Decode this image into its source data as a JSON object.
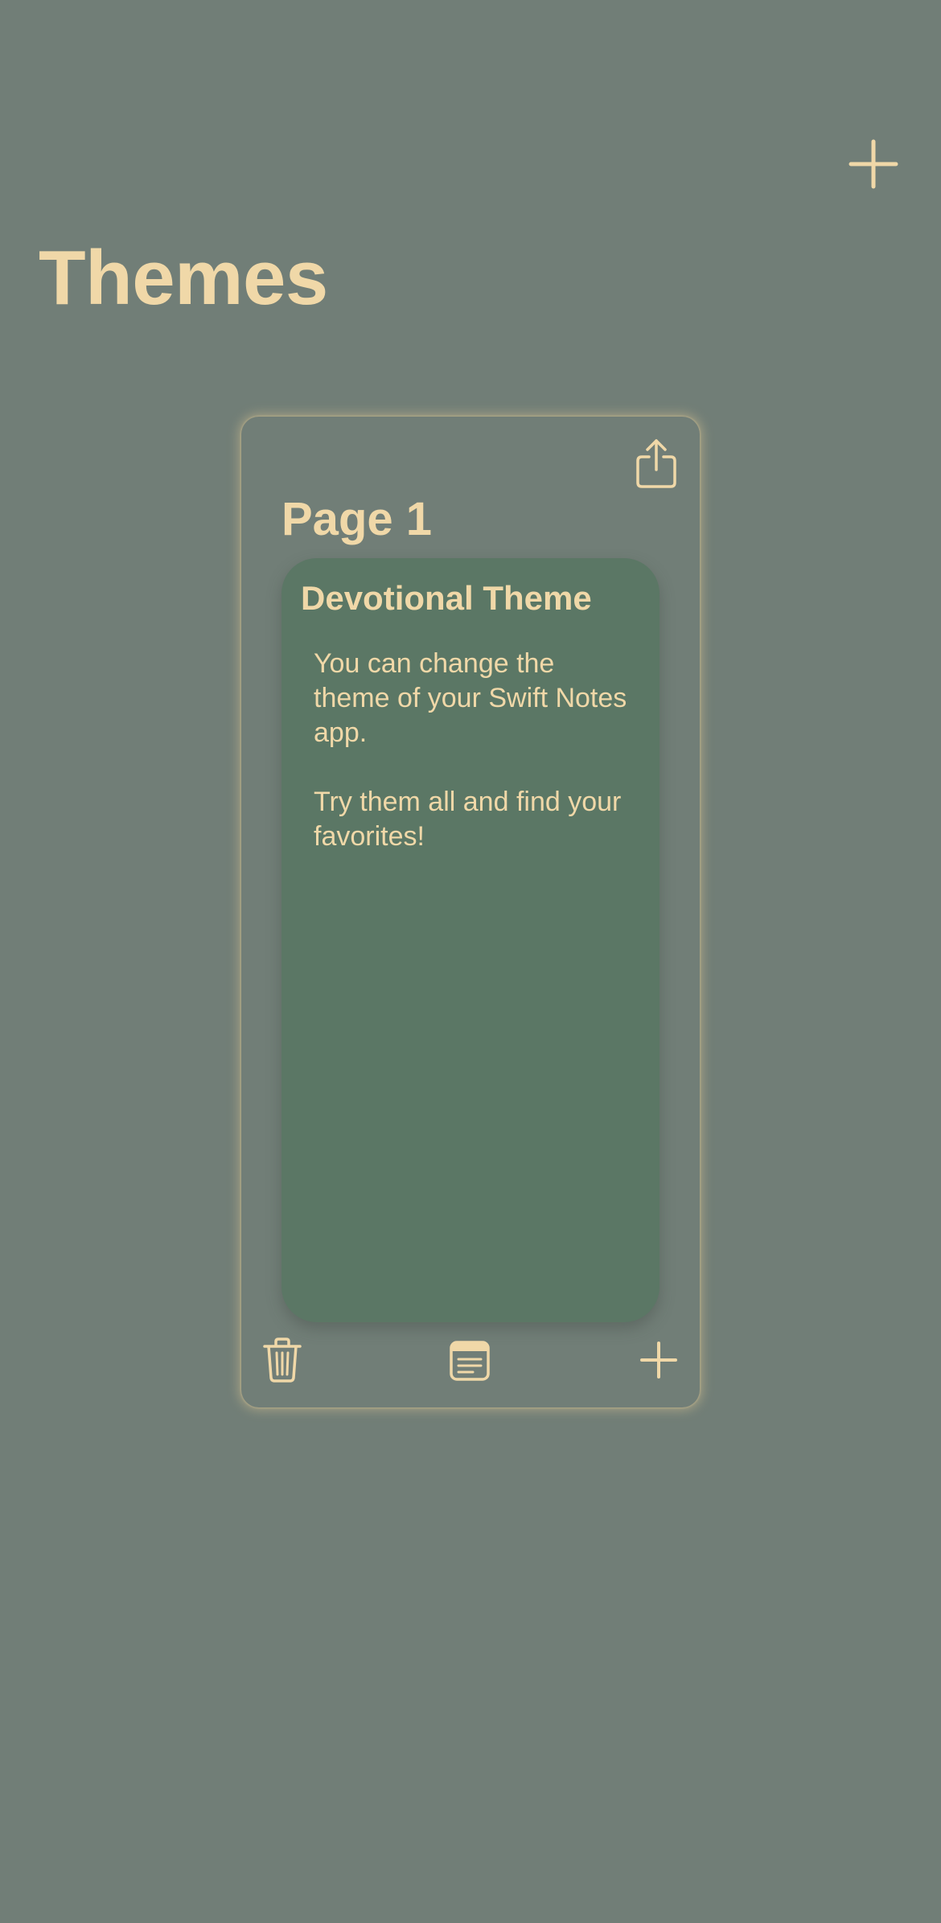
{
  "header": {
    "title": "Themes",
    "add_icon": "plus-icon"
  },
  "book": {
    "share_icon": "share-icon",
    "page_label": "Page 1",
    "note": {
      "title": "Devotional Theme",
      "paragraphs": [
        "You can change the theme of your Swift Notes app.",
        "Try them all and find your favorites!"
      ]
    },
    "toolbar": {
      "delete_icon": "trash-icon",
      "notes_icon": "note-list-icon",
      "add_icon": "plus-icon"
    }
  },
  "colors": {
    "background": "#717e77",
    "accent": "#f0d8a8",
    "note_background": "#5b7765"
  }
}
